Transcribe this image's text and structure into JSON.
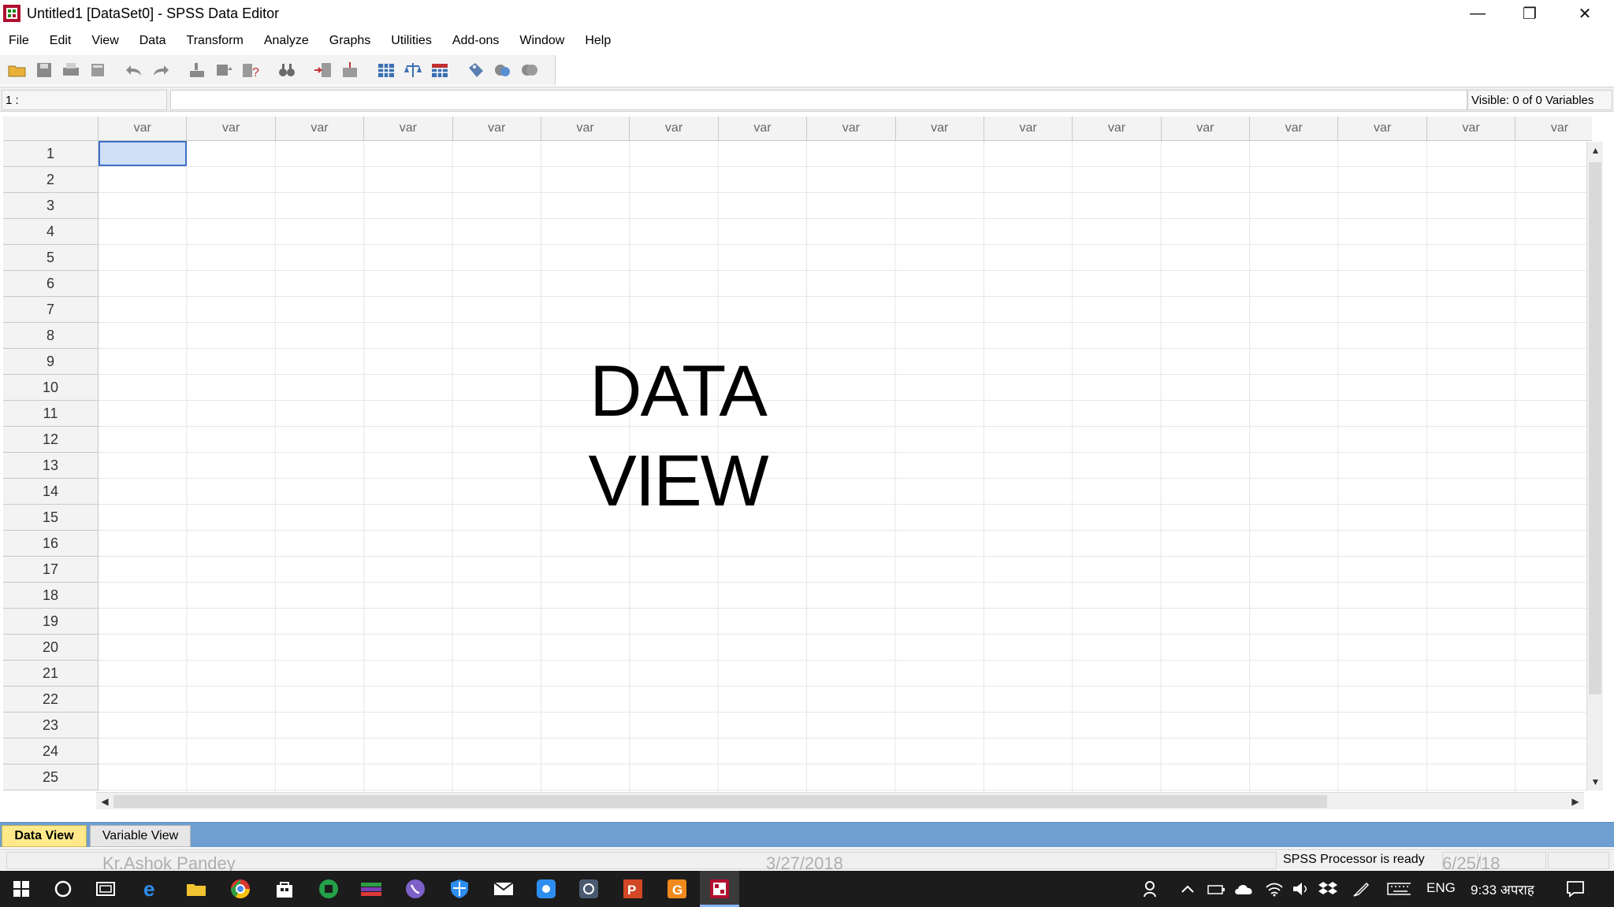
{
  "window": {
    "title": "Untitled1 [DataSet0] - SPSS Data Editor",
    "minimize": "—",
    "restore": "❐",
    "close": "✕"
  },
  "menu": [
    "File",
    "Edit",
    "View",
    "Data",
    "Transform",
    "Analyze",
    "Graphs",
    "Utilities",
    "Add-ons",
    "Window",
    "Help"
  ],
  "toolbar": {
    "icons": [
      "open-folder-icon",
      "save-icon",
      "print-icon",
      "dialog-recall-icon",
      "undo-icon",
      "redo-icon",
      "goto-case-icon",
      "goto-variable-icon",
      "variables-icon",
      "find-icon",
      "insert-cases-icon",
      "insert-variable-icon",
      "split-file-icon",
      "weight-cases-icon",
      "select-cases-icon",
      "value-labels-icon",
      "use-sets-icon",
      "show-all-variables-icon"
    ]
  },
  "editor": {
    "cell_ref": "1 :",
    "cell_value": "",
    "visible": "Visible: 0 of 0 Variables"
  },
  "grid": {
    "column_header": "var",
    "column_count": 17,
    "rows": [
      "1",
      "2",
      "3",
      "4",
      "5",
      "6",
      "7",
      "8",
      "9",
      "10",
      "11",
      "12",
      "13",
      "14",
      "15",
      "16",
      "17",
      "18",
      "19",
      "20",
      "21",
      "22",
      "23",
      "24",
      "25"
    ],
    "active_cell": {
      "row": 1,
      "col": 1
    }
  },
  "overlay": {
    "line1": "DATA",
    "line2": "VIEW"
  },
  "tabs": {
    "data_view": "Data View",
    "variable_view": "Variable View",
    "active": "Data View"
  },
  "status": {
    "processor": "SPSS  Processor is ready"
  },
  "watermarks": {
    "author": "Kr.Ashok Pandey",
    "date": "3/27/2018",
    "date2": "6/25/18"
  },
  "taskbar": {
    "lang": "ENG",
    "time": "9:33 अपराह"
  },
  "colors": {
    "active_tab": "#ffe98a",
    "tab_bar": "#6f9fd1",
    "active_cell": "#cfe0f7",
    "app_icon": "#b01030"
  }
}
